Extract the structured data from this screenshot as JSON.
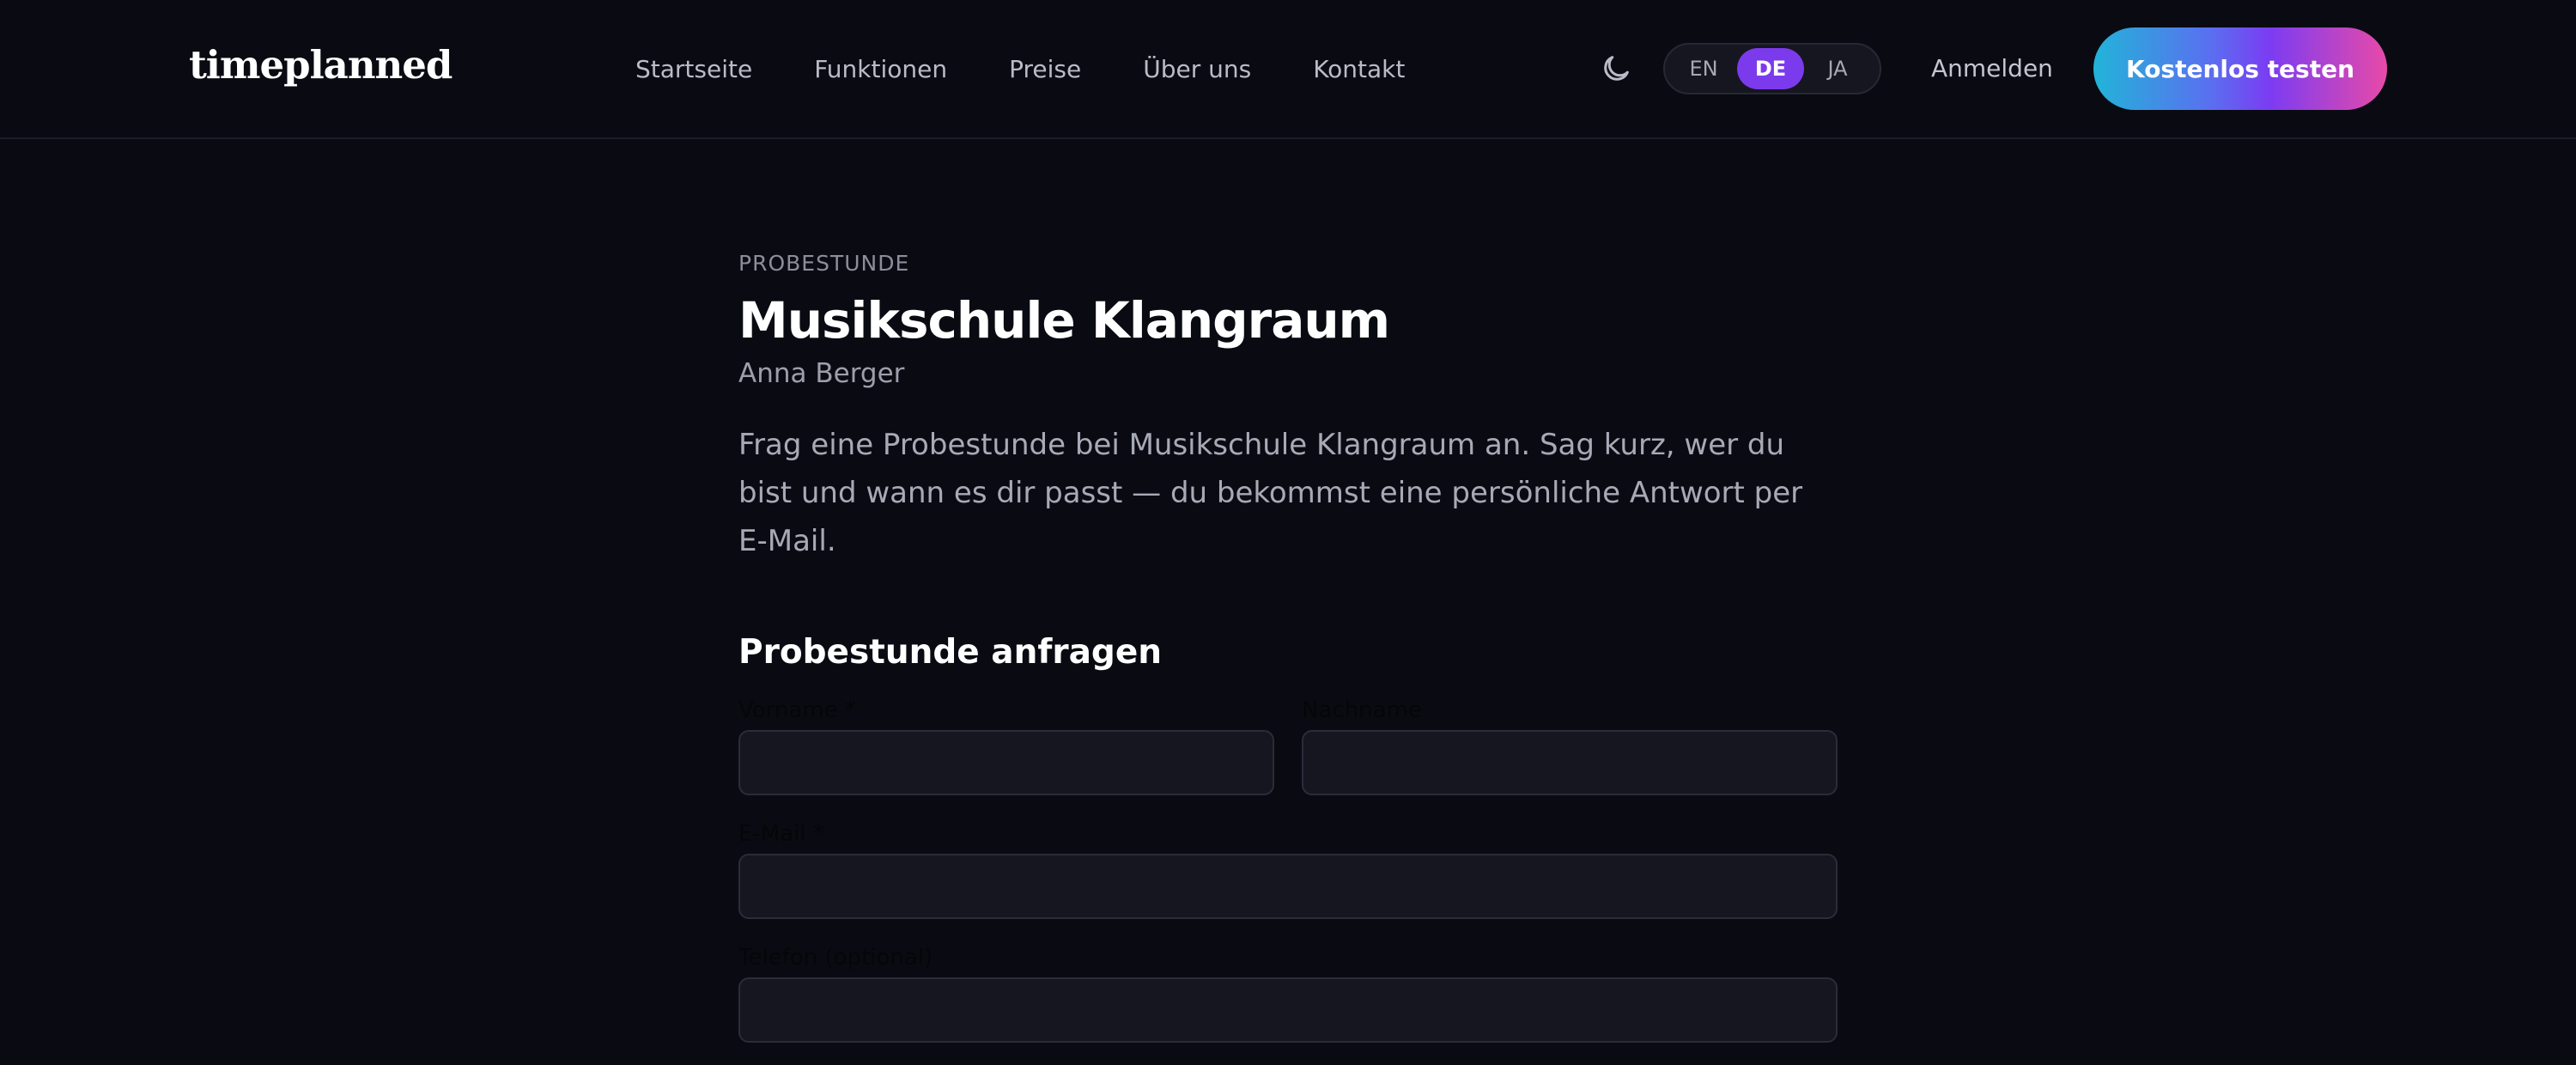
{
  "header": {
    "logo": "timeplanned",
    "nav": [
      "Startseite",
      "Funktionen",
      "Preise",
      "Über uns",
      "Kontakt"
    ],
    "theme_icon": "moon-icon",
    "languages": [
      "EN",
      "DE",
      "JA"
    ],
    "active_language": "DE",
    "login_label": "Anmelden",
    "cta_label": "Kostenlos testen"
  },
  "main": {
    "eyebrow": "PROBESTUNDE",
    "title": "Musikschule Klangraum",
    "person": "Anna Berger",
    "intro": "Frag eine Probestunde bei Musikschule Klangraum an. Sag kurz, wer du bist und wann es dir passt — du bekommst eine persönliche Antwort per E-Mail."
  },
  "form": {
    "title": "Probestunde anfragen",
    "first_name_label": "Vorname *",
    "last_name_label": "Nachname",
    "email_label": "E-Mail *",
    "phone_label": "Telefon (optional)",
    "first_name_value": "",
    "last_name_value": "",
    "email_value": "",
    "phone_value": ""
  },
  "colors": {
    "background": "#0a0b12",
    "accent": "#7c3aed",
    "input_bg": "#15161f",
    "cta_gradient_start": "#22b4d8",
    "cta_gradient_end": "#e84aa8"
  }
}
